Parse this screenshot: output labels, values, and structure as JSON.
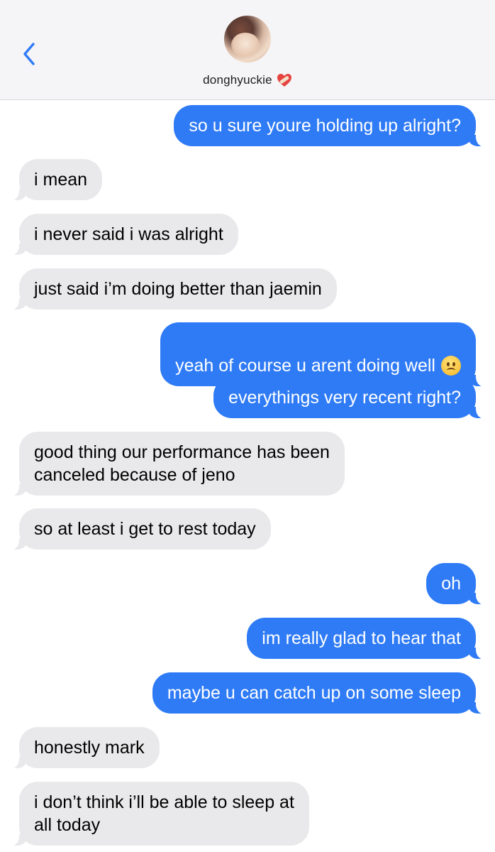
{
  "header": {
    "contact_name": "donghyuckie",
    "back_icon": "chevron-left-icon",
    "avatar": "contact-avatar",
    "name_badge": "mending-heart-emoji-icon",
    "accent_color": "#2f7bf6"
  },
  "messages": [
    {
      "from": "me",
      "text": "so u sure youre holding up alright?"
    },
    {
      "from": "them",
      "text": "i mean"
    },
    {
      "from": "them",
      "text": "i never said i was alright"
    },
    {
      "from": "them",
      "text": "just said i’m doing better than jaemin"
    },
    {
      "from": "me",
      "text": "yeah of course u arent doing well",
      "emoji": "slightly-frowning-face-emoji-icon"
    },
    {
      "from": "me",
      "text": "everythings very recent right?"
    },
    {
      "from": "them",
      "text": "good thing our performance has been\ncanceled because of jeno"
    },
    {
      "from": "them",
      "text": "so at least i get to rest today"
    },
    {
      "from": "me",
      "text": "oh"
    },
    {
      "from": "me",
      "text": "im really glad to hear that"
    },
    {
      "from": "me",
      "text": "maybe u can catch up on some sleep"
    },
    {
      "from": "them",
      "text": "honestly mark"
    },
    {
      "from": "them",
      "text": "i don’t think i’ll be able to sleep at\nall today"
    }
  ]
}
